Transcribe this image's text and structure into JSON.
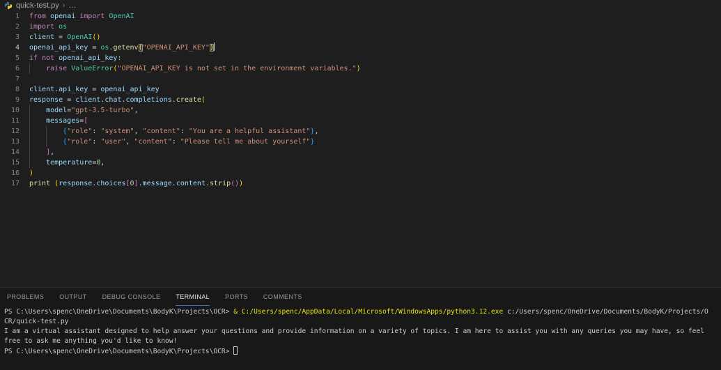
{
  "breadcrumb": {
    "file": "quick-test.py",
    "separator": "›",
    "ellipsis": "…"
  },
  "colors": {
    "editor_bg": "#1E1E1E",
    "panel_bg": "#181818",
    "keyword": "#C586C0",
    "variable": "#9CDCFE",
    "type": "#4EC9B0",
    "function": "#DCDCAA",
    "string": "#CE9178",
    "number": "#B5CEA8",
    "default_text": "#D4D4D4",
    "bracket_gold": "#FFD700",
    "bracket_pink": "#DA70D6",
    "bracket_blue": "#179FFF",
    "line_number": "#858585",
    "line_number_active": "#C6C6C6",
    "tab_active_underline": "#2F7AD2",
    "terminal_yellow": "#E5E510",
    "python_icon_blue": "#3874A5",
    "python_icon_yellow": "#FFD43B"
  },
  "editor": {
    "lines": [
      {
        "n": "1",
        "indent": 0,
        "tokens": [
          {
            "t": "from ",
            "c": "kw"
          },
          {
            "t": "openai ",
            "c": "var"
          },
          {
            "t": "import ",
            "c": "kw"
          },
          {
            "t": "OpenAI",
            "c": "type"
          }
        ]
      },
      {
        "n": "2",
        "indent": 0,
        "tokens": [
          {
            "t": "import ",
            "c": "kw"
          },
          {
            "t": "os",
            "c": "type"
          }
        ]
      },
      {
        "n": "3",
        "indent": 0,
        "tokens": [
          {
            "t": "client",
            "c": "var"
          },
          {
            "t": " = ",
            "c": "op"
          },
          {
            "t": "OpenAI",
            "c": "type"
          },
          {
            "t": "()",
            "c": "b1"
          }
        ]
      },
      {
        "n": "4",
        "active": true,
        "indent": 0,
        "tokens": [
          {
            "t": "openai_api_key",
            "c": "var"
          },
          {
            "t": " = ",
            "c": "op"
          },
          {
            "t": "os",
            "c": "type"
          },
          {
            "t": ".",
            "c": "op"
          },
          {
            "t": "getenv",
            "c": "fn"
          },
          {
            "t": "(",
            "c": "b1",
            "box": true
          },
          {
            "t": "\"OPENAI_API_KEY\"",
            "c": "str"
          },
          {
            "t": ")",
            "c": "b1",
            "box": true
          },
          {
            "t": "",
            "c": "cursor"
          }
        ]
      },
      {
        "n": "5",
        "indent": 0,
        "tokens": [
          {
            "t": "if ",
            "c": "kw"
          },
          {
            "t": "not ",
            "c": "kw"
          },
          {
            "t": "openai_api_key",
            "c": "var"
          },
          {
            "t": ":",
            "c": "op"
          }
        ]
      },
      {
        "n": "6",
        "indent": 1,
        "tokens": [
          {
            "t": "raise ",
            "c": "kw"
          },
          {
            "t": "ValueError",
            "c": "type"
          },
          {
            "t": "(",
            "c": "b1"
          },
          {
            "t": "\"OPENAI_API_KEY is not set in the environment variables.\"",
            "c": "str"
          },
          {
            "t": ")",
            "c": "b1"
          }
        ]
      },
      {
        "n": "7",
        "indent": 0,
        "tokens": []
      },
      {
        "n": "8",
        "indent": 0,
        "tokens": [
          {
            "t": "client",
            "c": "var"
          },
          {
            "t": ".",
            "c": "op"
          },
          {
            "t": "api_key",
            "c": "var"
          },
          {
            "t": " = ",
            "c": "op"
          },
          {
            "t": "openai_api_key",
            "c": "var"
          }
        ]
      },
      {
        "n": "9",
        "indent": 0,
        "tokens": [
          {
            "t": "response",
            "c": "var"
          },
          {
            "t": " = ",
            "c": "op"
          },
          {
            "t": "client",
            "c": "var"
          },
          {
            "t": ".",
            "c": "op"
          },
          {
            "t": "chat",
            "c": "var"
          },
          {
            "t": ".",
            "c": "op"
          },
          {
            "t": "completions",
            "c": "var"
          },
          {
            "t": ".",
            "c": "op"
          },
          {
            "t": "create",
            "c": "fn"
          },
          {
            "t": "(",
            "c": "b1"
          }
        ]
      },
      {
        "n": "10",
        "indent": 1,
        "tokens": [
          {
            "t": "model",
            "c": "var"
          },
          {
            "t": "=",
            "c": "op"
          },
          {
            "t": "\"gpt-3.5-turbo\"",
            "c": "str"
          },
          {
            "t": ",",
            "c": "op"
          }
        ]
      },
      {
        "n": "11",
        "indent": 1,
        "tokens": [
          {
            "t": "messages",
            "c": "var"
          },
          {
            "t": "=",
            "c": "op"
          },
          {
            "t": "[",
            "c": "b2"
          }
        ]
      },
      {
        "n": "12",
        "indent": 2,
        "tokens": [
          {
            "t": "{",
            "c": "b3"
          },
          {
            "t": "\"role\"",
            "c": "str"
          },
          {
            "t": ": ",
            "c": "op"
          },
          {
            "t": "\"system\"",
            "c": "str"
          },
          {
            "t": ", ",
            "c": "op"
          },
          {
            "t": "\"content\"",
            "c": "str"
          },
          {
            "t": ": ",
            "c": "op"
          },
          {
            "t": "\"You are a helpful assistant\"",
            "c": "str"
          },
          {
            "t": "}",
            "c": "b3"
          },
          {
            "t": ",",
            "c": "op"
          }
        ]
      },
      {
        "n": "13",
        "indent": 2,
        "tokens": [
          {
            "t": "{",
            "c": "b3"
          },
          {
            "t": "\"role\"",
            "c": "str"
          },
          {
            "t": ": ",
            "c": "op"
          },
          {
            "t": "\"user\"",
            "c": "str"
          },
          {
            "t": ", ",
            "c": "op"
          },
          {
            "t": "\"content\"",
            "c": "str"
          },
          {
            "t": ": ",
            "c": "op"
          },
          {
            "t": "\"Please tell me about yourself\"",
            "c": "str"
          },
          {
            "t": "}",
            "c": "b3"
          }
        ]
      },
      {
        "n": "14",
        "indent": 1,
        "tokens": [
          {
            "t": "]",
            "c": "b2"
          },
          {
            "t": ",",
            "c": "op"
          }
        ]
      },
      {
        "n": "15",
        "indent": 1,
        "tokens": [
          {
            "t": "temperature",
            "c": "var"
          },
          {
            "t": "=",
            "c": "op"
          },
          {
            "t": "0",
            "c": "num"
          },
          {
            "t": ",",
            "c": "op"
          }
        ]
      },
      {
        "n": "16",
        "indent": 0,
        "tokens": [
          {
            "t": ")",
            "c": "b1"
          }
        ]
      },
      {
        "n": "17",
        "indent": 0,
        "tokens": [
          {
            "t": "print ",
            "c": "fn"
          },
          {
            "t": "(",
            "c": "b1"
          },
          {
            "t": "response",
            "c": "var"
          },
          {
            "t": ".",
            "c": "op"
          },
          {
            "t": "choices",
            "c": "var"
          },
          {
            "t": "[",
            "c": "b2"
          },
          {
            "t": "0",
            "c": "num"
          },
          {
            "t": "]",
            "c": "b2"
          },
          {
            "t": ".",
            "c": "op"
          },
          {
            "t": "message",
            "c": "var"
          },
          {
            "t": ".",
            "c": "op"
          },
          {
            "t": "content",
            "c": "var"
          },
          {
            "t": ".",
            "c": "op"
          },
          {
            "t": "strip",
            "c": "fn"
          },
          {
            "t": "()",
            "c": "b2"
          },
          {
            "t": ")",
            "c": "b1"
          }
        ]
      }
    ]
  },
  "panel": {
    "tabs": [
      {
        "label": "PROBLEMS",
        "active": false
      },
      {
        "label": "OUTPUT",
        "active": false
      },
      {
        "label": "DEBUG CONSOLE",
        "active": false
      },
      {
        "label": "TERMINAL",
        "active": true
      },
      {
        "label": "PORTS",
        "active": false
      },
      {
        "label": "COMMENTS",
        "active": false
      }
    ],
    "terminal_lines": [
      [
        {
          "t": "PS C:\\Users\\spenc\\OneDrive\\Documents\\BodyK\\Projects\\OCR> ",
          "c": "def"
        },
        {
          "t": "& C:/Users/spenc/AppData/Local/Microsoft/WindowsApps/python3.12.exe",
          "c": "yel"
        },
        {
          "t": " c:/Users/spenc/OneDrive/Documents/BodyK/Projects/O",
          "c": "def"
        }
      ],
      [
        {
          "t": "CR/quick-test.py",
          "c": "def"
        }
      ],
      [
        {
          "t": "I am a virtual assistant designed to help answer your questions and provide information on a variety of topics. I am here to assist you with any queries you may have, so feel",
          "c": "def"
        }
      ],
      [
        {
          "t": "free to ask me anything you'd like to know!",
          "c": "def"
        }
      ],
      [
        {
          "t": "PS C:\\Users\\spenc\\OneDrive\\Documents\\BodyK\\Projects\\OCR> ",
          "c": "def"
        },
        {
          "t": "",
          "c": "cursorbox"
        }
      ]
    ]
  }
}
